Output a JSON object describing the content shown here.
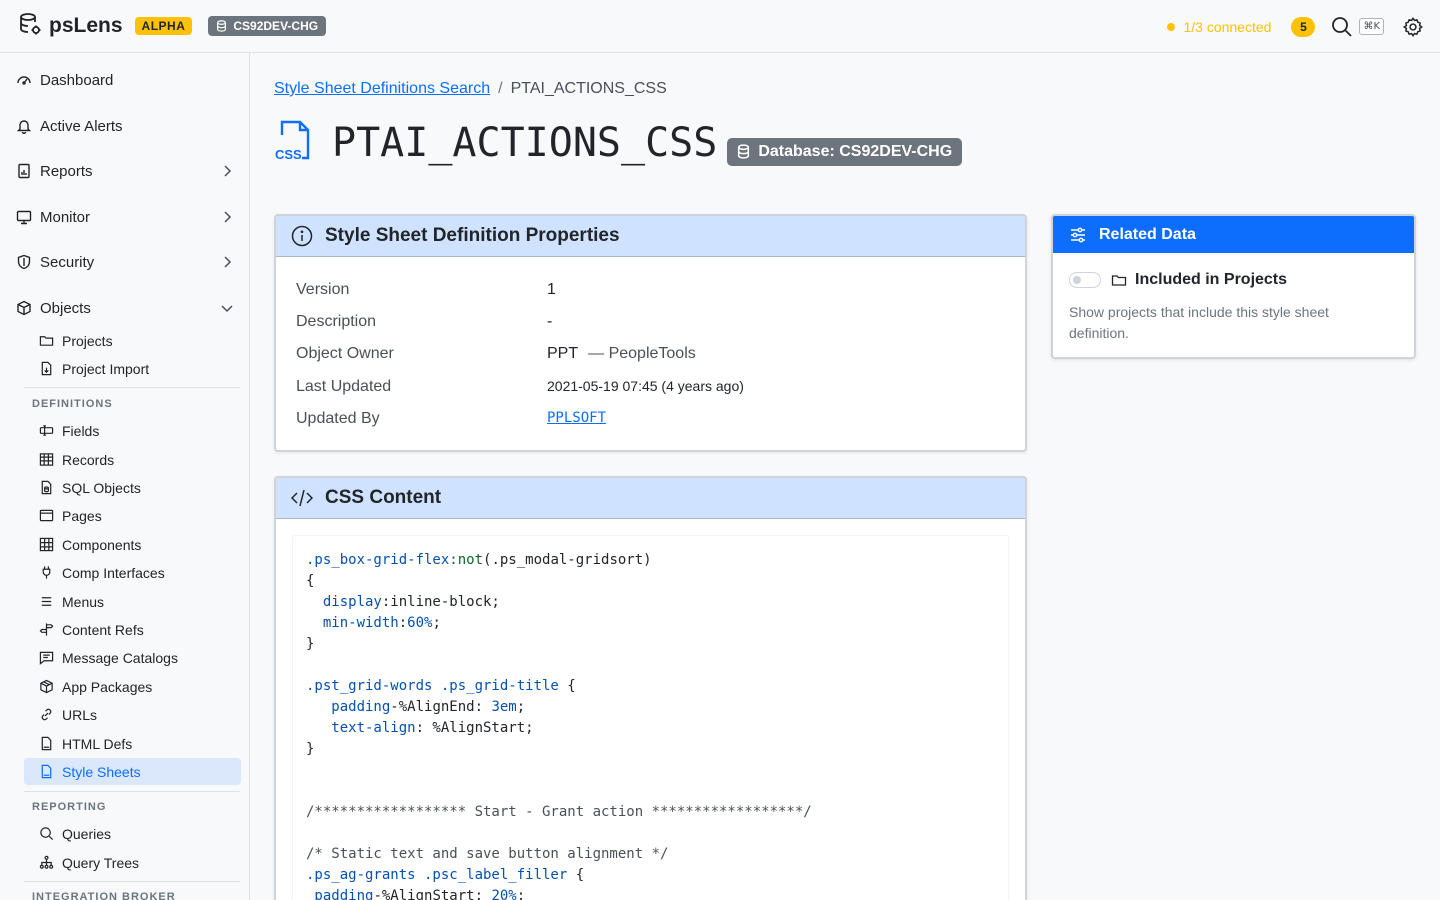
{
  "header": {
    "brand": "psLens",
    "badge": "ALPHA",
    "database": "CS92DEV-CHG",
    "connection_status": "1/3 connected",
    "notifications": "5",
    "shortcut": "⌘K"
  },
  "sidebar": {
    "main": [
      {
        "label": "Dashboard",
        "icon": "dashboard-icon"
      },
      {
        "label": "Active Alerts",
        "icon": "bell-icon"
      },
      {
        "label": "Reports",
        "icon": "report-icon"
      },
      {
        "label": "Monitor",
        "icon": "monitor-icon"
      },
      {
        "label": "Security",
        "icon": "shield-icon"
      },
      {
        "label": "Objects",
        "icon": "box-icon"
      }
    ],
    "objects": [
      {
        "label": "Projects",
        "icon": "folder-icon"
      },
      {
        "label": "Project Import",
        "icon": "file-import-icon"
      }
    ],
    "definitions_header": "DEFINITIONS",
    "definitions": [
      {
        "label": "Fields",
        "icon": "field-icon"
      },
      {
        "label": "Records",
        "icon": "table-icon"
      },
      {
        "label": "SQL Objects",
        "icon": "sql-file-icon"
      },
      {
        "label": "Pages",
        "icon": "page-icon"
      },
      {
        "label": "Components",
        "icon": "grid-icon"
      },
      {
        "label": "Comp Interfaces",
        "icon": "plug-icon"
      },
      {
        "label": "Menus",
        "icon": "menu-icon"
      },
      {
        "label": "Content Refs",
        "icon": "signpost-icon"
      },
      {
        "label": "Message Catalogs",
        "icon": "message-icon"
      },
      {
        "label": "App Packages",
        "icon": "package-icon"
      },
      {
        "label": "URLs",
        "icon": "link-icon"
      },
      {
        "label": "HTML Defs",
        "icon": "html-file-icon"
      },
      {
        "label": "Style Sheets",
        "icon": "css-file-icon"
      }
    ],
    "reporting_header": "REPORTING",
    "reporting": [
      {
        "label": "Queries",
        "icon": "search-icon"
      },
      {
        "label": "Query Trees",
        "icon": "tree-icon"
      }
    ],
    "integration_header": "INTEGRATION BROKER"
  },
  "breadcrumb": {
    "parent": "Style Sheet Definitions Search",
    "separator": "/",
    "current": "PTAI_ACTIONS_CSS"
  },
  "page": {
    "title": "PTAI_ACTIONS_CSS",
    "database_badge": "Database: CS92DEV-CHG"
  },
  "properties": {
    "title": "Style Sheet Definition Properties",
    "rows": [
      {
        "label": "Version",
        "value": "1"
      },
      {
        "label": "Description",
        "value": "-"
      },
      {
        "label": "Object Owner",
        "value": "PPT",
        "extra": "— PeopleTools"
      },
      {
        "label": "Last Updated",
        "value": "2021-05-19 07:45 (4 years ago)"
      },
      {
        "label": "Updated By",
        "value": "PPLSOFT"
      }
    ]
  },
  "css_content": {
    "title": "CSS Content",
    "lines": [
      {
        "sel": ".ps_box-grid-flex",
        "fn": ":not",
        "rest": "(.ps_modal-gridsort)"
      },
      {
        "plain": "{"
      },
      {
        "prop": "  display",
        "rest": ":inline-block;"
      },
      {
        "prop": "  min-width",
        "rest": ":",
        "num": "60%",
        "end": ";"
      },
      {
        "plain": "}"
      },
      {
        "plain": ""
      },
      {
        "sel": ".pst_grid-words .ps_grid-title",
        "rest": " {"
      },
      {
        "prop": "   padding",
        "rest": "-%AlignEnd: ",
        "num": "3em",
        "end": ";"
      },
      {
        "prop": "   text-align",
        "rest": ": %AlignStart;"
      },
      {
        "plain": "}"
      },
      {
        "plain": ""
      },
      {
        "plain": ""
      },
      {
        "cmt": "/****************** Start - Grant action ******************/"
      },
      {
        "plain": ""
      },
      {
        "cmt": "/* Static text and save button alignment */"
      },
      {
        "sel": ".ps_ag-grants .psc_label_filler",
        "rest": " {"
      },
      {
        "prop": " padding",
        "rest": "-%AlignStart: ",
        "num": "20%",
        "end": ";"
      }
    ]
  },
  "related": {
    "title": "Related Data",
    "item_title": "Included in Projects",
    "item_desc": "Show projects that include this style sheet definition."
  }
}
